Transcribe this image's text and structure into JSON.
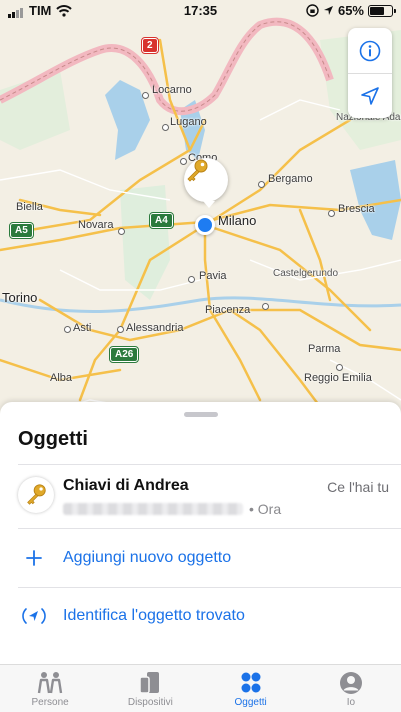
{
  "status_bar": {
    "carrier": "TIM",
    "time": "17:35",
    "battery_percent": "65%",
    "battery_level": 0.65
  },
  "map": {
    "cities": [
      {
        "name": "Locarno",
        "size": "normal"
      },
      {
        "name": "Lugano",
        "size": "normal"
      },
      {
        "name": "Como",
        "size": "normal"
      },
      {
        "name": "Bergamo",
        "size": "normal"
      },
      {
        "name": "Biella",
        "size": "normal"
      },
      {
        "name": "Novara",
        "size": "normal"
      },
      {
        "name": "Milano",
        "size": "big"
      },
      {
        "name": "Brescia",
        "size": "normal"
      },
      {
        "name": "Pavia",
        "size": "normal"
      },
      {
        "name": "Castelgerundo",
        "size": "small"
      },
      {
        "name": "Torino",
        "size": "big"
      },
      {
        "name": "Asti",
        "size": "normal"
      },
      {
        "name": "Alessandria",
        "size": "normal"
      },
      {
        "name": "Piacenza",
        "size": "normal"
      },
      {
        "name": "Parma",
        "size": "normal"
      },
      {
        "name": "Alba",
        "size": "normal"
      },
      {
        "name": "Reggio Emilia",
        "size": "normal"
      },
      {
        "name": "Nazionale Adamello",
        "size": "small"
      }
    ],
    "road_badges": [
      "2",
      "A5",
      "A4",
      "A26"
    ],
    "pin_icon": "key-icon",
    "controls": {
      "info_icon": "info-icon",
      "location_icon": "location-arrow-icon"
    }
  },
  "sheet": {
    "title": "Oggetti",
    "item": {
      "name": "Chiavi di Andrea",
      "time": "• Ora",
      "status": "Ce l'hai tu",
      "icon": "key-icon"
    },
    "actions": [
      {
        "label": "Aggiungi nuovo oggetto",
        "icon": "plus-icon"
      },
      {
        "label": "Identifica l'oggetto trovato",
        "icon": "airtag-identify-icon"
      }
    ]
  },
  "tabs": [
    {
      "label": "Persone",
      "icon": "people-icon",
      "active": false
    },
    {
      "label": "Dispositivi",
      "icon": "devices-icon",
      "active": false
    },
    {
      "label": "Oggetti",
      "icon": "items-icon",
      "active": true
    },
    {
      "label": "Io",
      "icon": "person-icon",
      "active": false
    }
  ],
  "colors": {
    "accent": "#1b72e8",
    "location_dot": "#1e7cf2",
    "motorway": "#2b7a3d",
    "border": "#d8322e"
  }
}
